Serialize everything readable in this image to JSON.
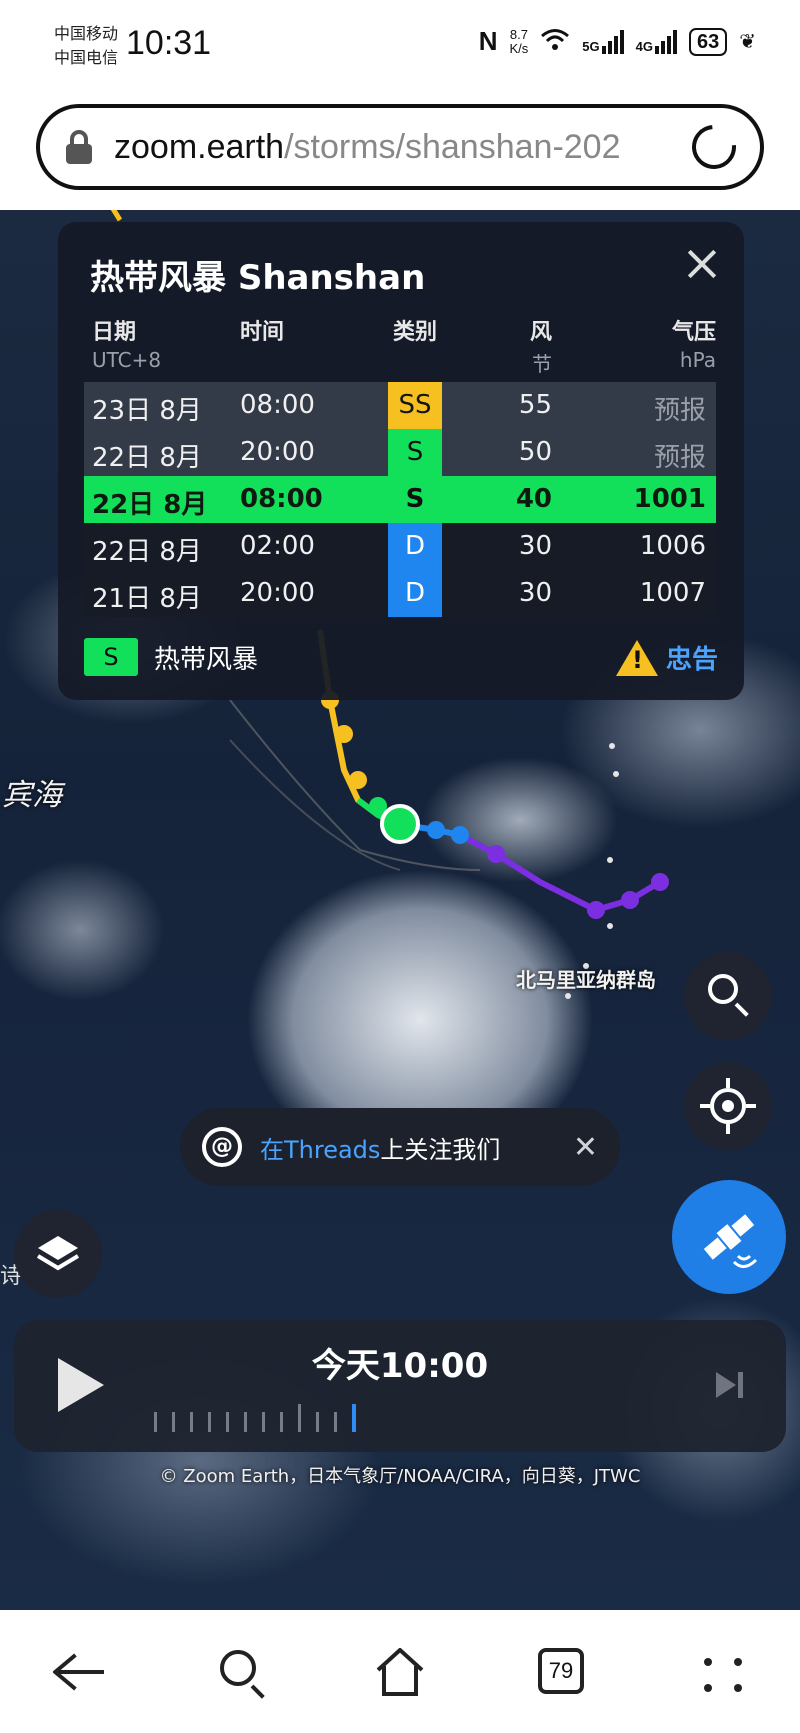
{
  "status_bar": {
    "carrier1": "中国移动",
    "carrier2": "中国电信",
    "time": "10:31",
    "nfc": "N",
    "speed_value": "8.7",
    "speed_unit": "K/s",
    "net1": "5G",
    "net2": "4G",
    "battery": "63"
  },
  "address_bar": {
    "host": "zoom.earth",
    "path": "/storms/shanshan-202"
  },
  "storm_panel": {
    "title": "热带风暴 Shanshan",
    "headers": {
      "date": "日期",
      "date_sub": "UTC+8",
      "time": "时间",
      "category": "类别",
      "wind": "风",
      "wind_sub": "节",
      "pressure": "气压",
      "pressure_sub": "hPa"
    },
    "rows": [
      {
        "date": "23日 8月",
        "time": "08:00",
        "category": "SS",
        "wind": "55",
        "pressure": "预报"
      },
      {
        "date": "22日 8月",
        "time": "20:00",
        "category": "S",
        "wind": "50",
        "pressure": "预报"
      },
      {
        "date": "22日 8月",
        "time": "08:00",
        "category": "S",
        "wind": "40",
        "pressure": "1001"
      },
      {
        "date": "22日 8月",
        "time": "02:00",
        "category": "D",
        "wind": "30",
        "pressure": "1006"
      },
      {
        "date": "21日 8月",
        "time": "20:00",
        "category": "D",
        "wind": "30",
        "pressure": "1007"
      }
    ],
    "legend_code": "S",
    "legend_label": "热带风暴",
    "warning_label": "忠告"
  },
  "map": {
    "label_left": "宾海",
    "label_islands": "北马里亚纳群岛",
    "label_edge": "诗"
  },
  "threads_banner": {
    "icon": "@",
    "text_highlight": "在Threads",
    "text_rest": "上关注我们",
    "close": "✕"
  },
  "timeline": {
    "time_label": "今天10:00"
  },
  "credits": "© Zoom Earth，日本气象厅/NOAA/CIRA，向日葵，JTWC",
  "bottom_nav": {
    "tab_count": "79"
  },
  "colors": {
    "tropical_storm": "#13e05a",
    "severe_storm": "#f6c021",
    "depression": "#1f86f0",
    "track_past": "#7b2fe0",
    "warning_link": "#4aa3ff"
  }
}
